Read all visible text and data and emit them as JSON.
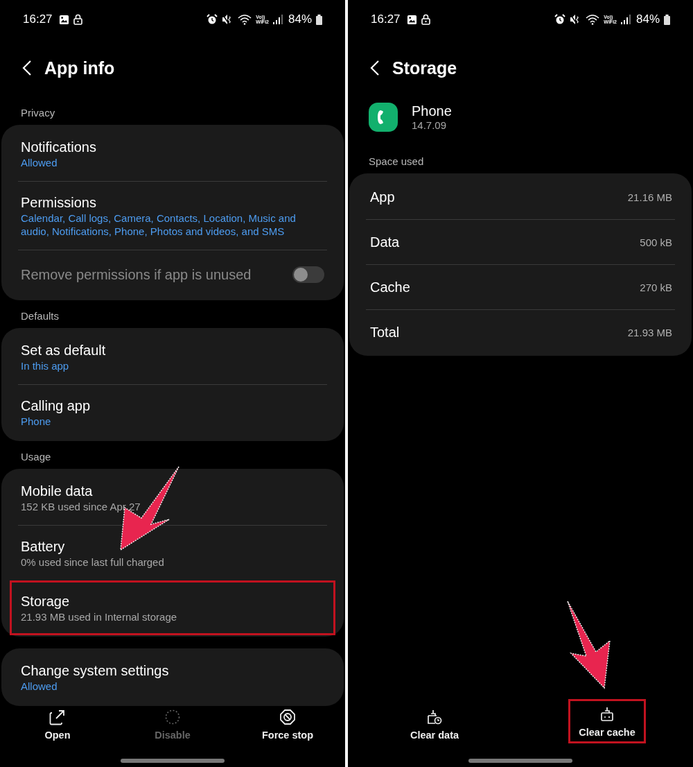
{
  "app_info_screen": {
    "status_bar": {
      "time": "16:27",
      "volte_top": "Vo))",
      "volte_bottom": "WiFi2",
      "battery": "84%"
    },
    "title": "App info",
    "sections": [
      {
        "label": "Privacy",
        "items": [
          {
            "kind": "link",
            "title": "Notifications",
            "subtitle": "Allowed",
            "accent": true,
            "highlighted": false
          },
          {
            "kind": "link",
            "title": "Permissions",
            "subtitle": "Calendar, Call logs, Camera, Contacts, Location, Music and audio, Notifications, Phone, Photos and videos, and SMS",
            "accent": true,
            "highlighted": false
          },
          {
            "kind": "toggle",
            "title": "Remove permissions if app is unused",
            "disabled": true,
            "on": false
          }
        ]
      },
      {
        "label": "Defaults",
        "items": [
          {
            "kind": "link",
            "title": "Set as default",
            "subtitle": "In this app",
            "accent": true,
            "highlighted": false
          },
          {
            "kind": "link",
            "title": "Calling app",
            "subtitle": "Phone",
            "accent": true,
            "highlighted": false
          }
        ]
      },
      {
        "label": "Usage",
        "items": [
          {
            "kind": "link",
            "title": "Mobile data",
            "subtitle": "152 KB used since Apr 27",
            "accent": false,
            "highlighted": false
          },
          {
            "kind": "link",
            "title": "Battery",
            "subtitle": "0% used since last full charged",
            "accent": false,
            "highlighted": false
          },
          {
            "kind": "link",
            "title": "Storage",
            "subtitle": "21.93 MB used in Internal storage",
            "accent": false,
            "highlighted": true
          }
        ]
      },
      {
        "items": [
          {
            "kind": "link",
            "title": "Change system settings",
            "subtitle": "Allowed",
            "accent": true,
            "highlighted": false
          }
        ]
      }
    ],
    "actions": [
      {
        "label": "Open",
        "disabled": false,
        "highlighted": false
      },
      {
        "label": "Disable",
        "disabled": true,
        "highlighted": false
      },
      {
        "label": "Force stop",
        "disabled": false,
        "highlighted": false
      }
    ]
  },
  "storage_screen": {
    "status_bar": {
      "time": "16:27",
      "volte_top": "Vo))",
      "volte_bottom": "WiFi2",
      "battery": "84%"
    },
    "title": "Storage",
    "app": {
      "name": "Phone",
      "version": "14.7.09"
    },
    "section_label": "Space used",
    "rows": [
      {
        "label": "App",
        "value": "21.16 MB"
      },
      {
        "label": "Data",
        "value": "500 kB"
      },
      {
        "label": "Cache",
        "value": "270 kB"
      },
      {
        "label": "Total",
        "value": "21.93 MB"
      }
    ],
    "actions": [
      {
        "label": "Clear data",
        "disabled": false,
        "highlighted": false
      },
      {
        "label": "Clear cache",
        "disabled": false,
        "highlighted": true
      }
    ]
  }
}
